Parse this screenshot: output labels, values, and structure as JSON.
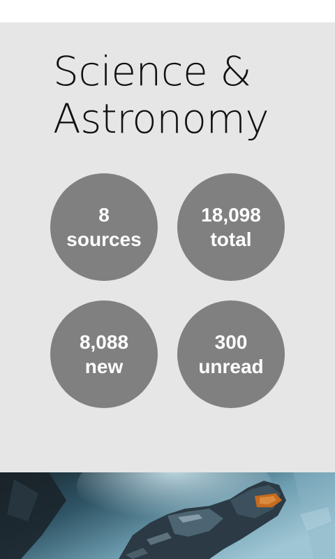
{
  "category": {
    "title_line1": "Science &",
    "title_line2": "Astronomy"
  },
  "stats": [
    {
      "value": "8",
      "label": "sources"
    },
    {
      "value": "18,098",
      "label": "total"
    },
    {
      "value": "8,088",
      "label": "new"
    },
    {
      "value": "300",
      "label": "unread"
    }
  ],
  "hero": {
    "image_subject": "armored-space-soldier",
    "colors": {
      "sky": "#3f6f82",
      "highlight": "#9fc6d4",
      "dark": "#14202a",
      "visor": "#c66a1e"
    }
  }
}
